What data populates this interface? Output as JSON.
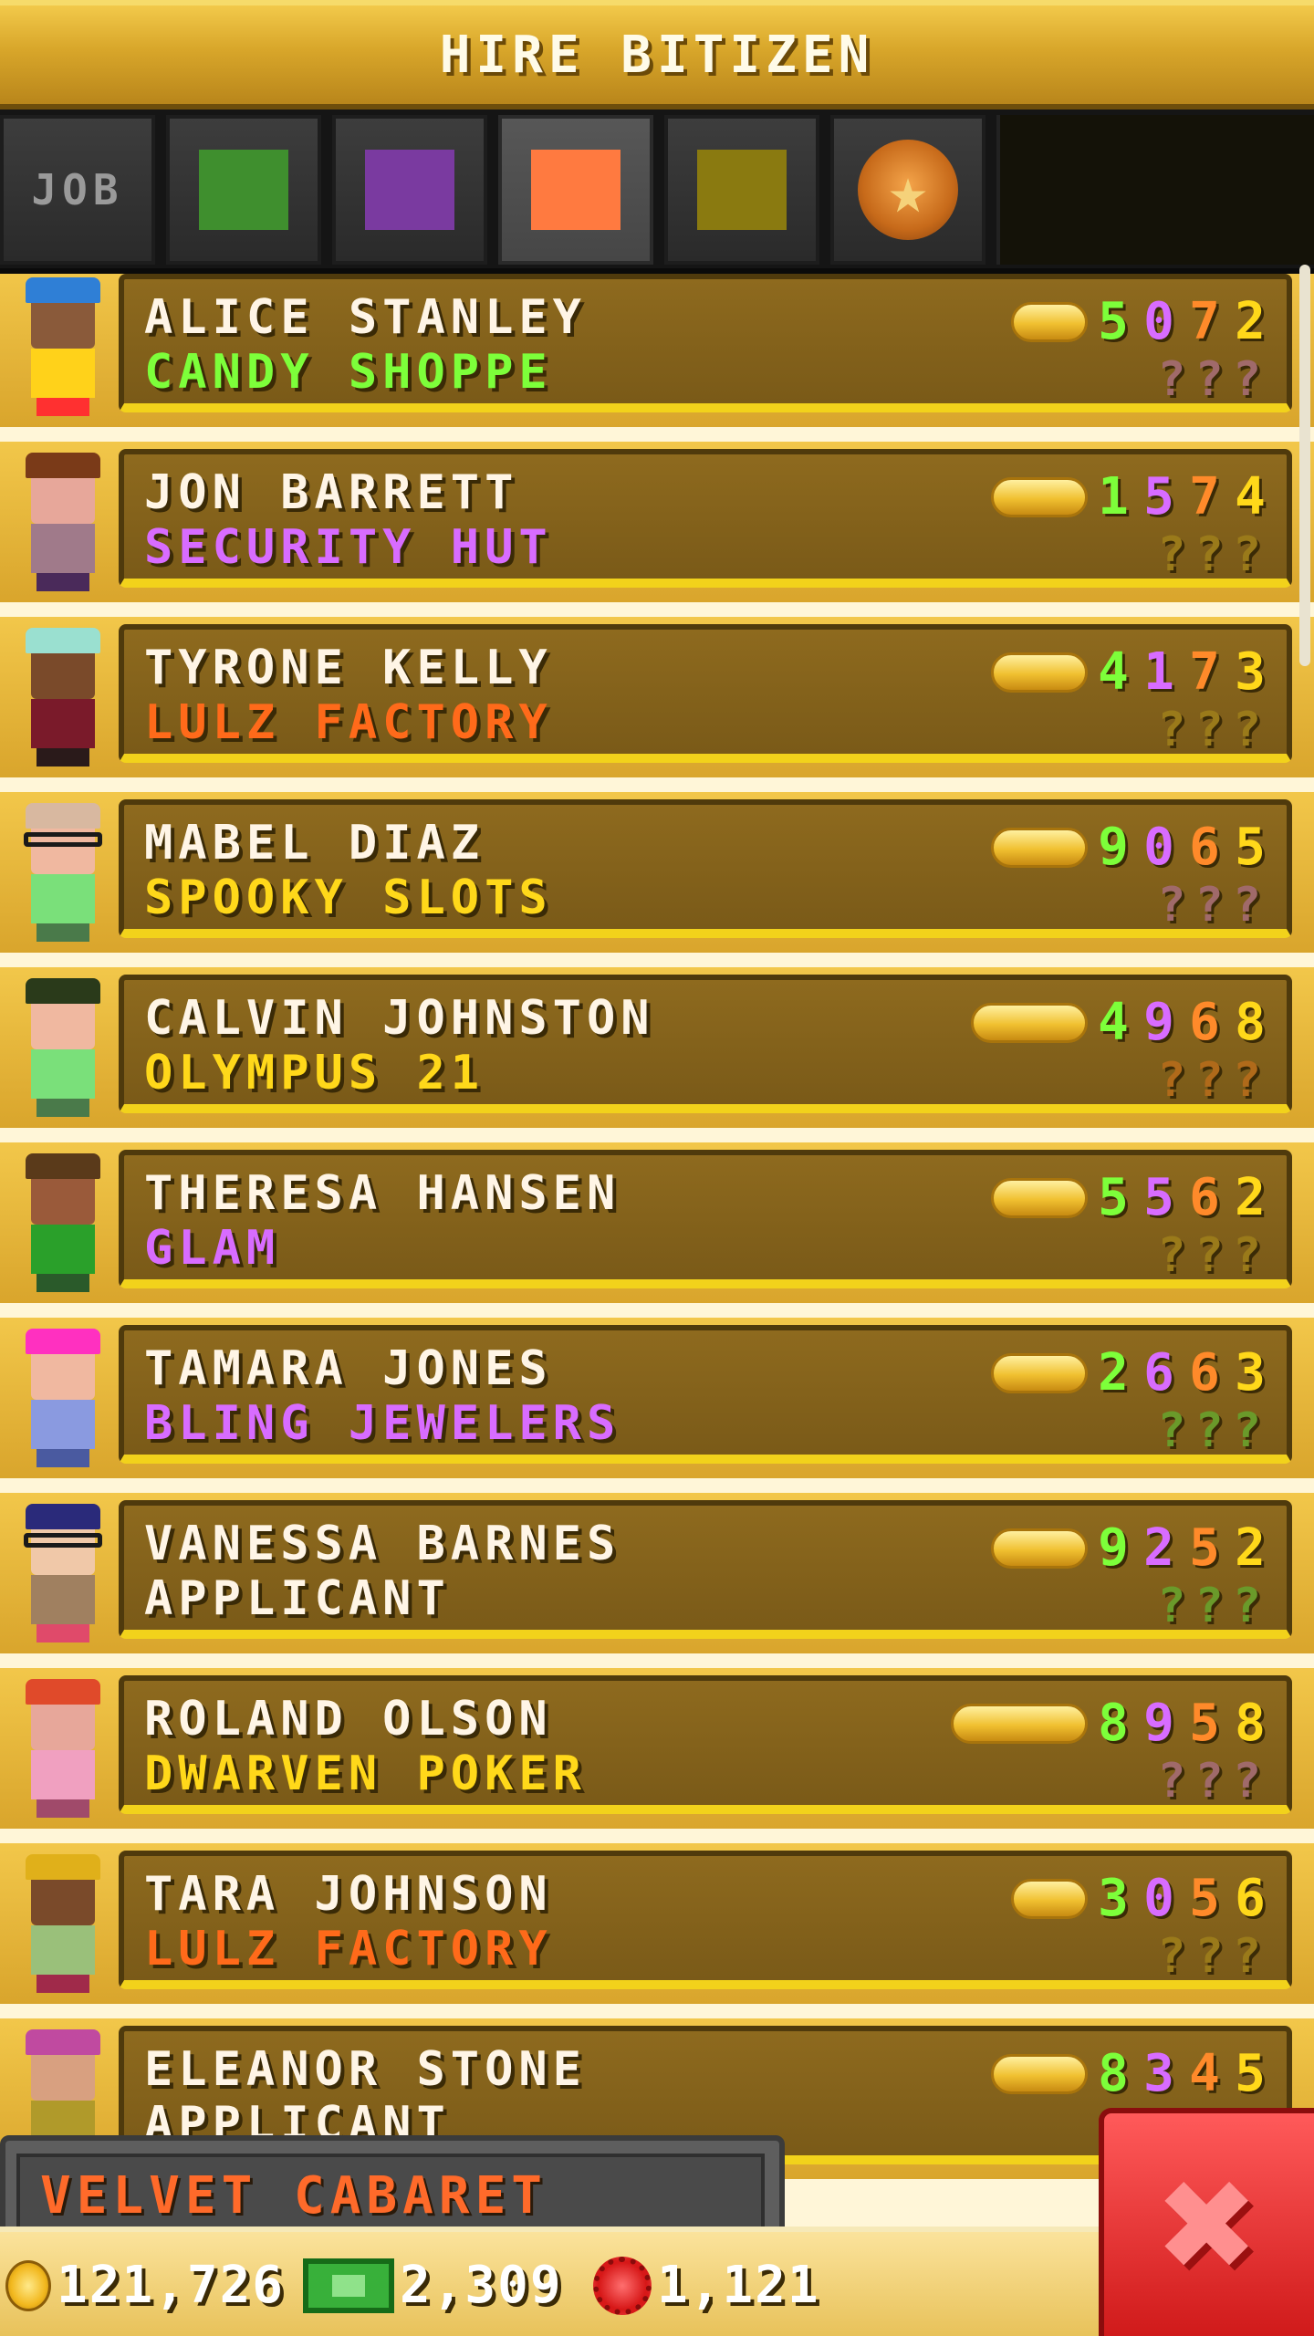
{
  "header": {
    "title": "HIRE BITIZEN"
  },
  "tabs": [
    {
      "label": "JOB",
      "kind": "text"
    },
    {
      "kind": "color",
      "color": "#3f8f2e"
    },
    {
      "kind": "color",
      "color": "#7a3aa0"
    },
    {
      "kind": "color",
      "color": "#ff7a40",
      "active": true
    },
    {
      "kind": "color",
      "color": "#8a7a10"
    },
    {
      "kind": "badge",
      "icon": "star-badge-icon",
      "glyph": "★"
    }
  ],
  "colors": {
    "green": "#7dff3a",
    "purple": "#d86cff",
    "orange": "#ff8a2a",
    "yellow": "#ffd81a",
    "white": "#fff5e6"
  },
  "rows": [
    {
      "name": "ALICE STANLEY",
      "job": "CANDY SHOPPE",
      "job_color": "#7dff3a",
      "coins": 2,
      "stats": [
        "5",
        "0",
        "7",
        "2"
      ],
      "stat_colors": [
        "#7dff3a",
        "#d86cff",
        "#ff8a2a",
        "#ffd81a"
      ],
      "unknown": "???",
      "unknown_color": "#a06a6a",
      "avatar": {
        "hair": "#2f7fd6",
        "skin": "#8a5a3a",
        "shirt": "#ffd21a",
        "legs": "#ff3030"
      }
    },
    {
      "name": "JON BARRETT",
      "job": "SECURITY HUT",
      "job_color": "#d86cff",
      "coins": 3,
      "stats": [
        "1",
        "5",
        "7",
        "4"
      ],
      "stat_colors": [
        "#7dff3a",
        "#d86cff",
        "#ff8a2a",
        "#ffd81a"
      ],
      "unknown": "???",
      "unknown_color": "#9a7a1a",
      "avatar": {
        "hair": "#7a3a18",
        "skin": "#e7a79a",
        "shirt": "#a07a8a",
        "legs": "#4a2a5a"
      }
    },
    {
      "name": "TYRONE KELLY",
      "job": "LULZ FACTORY",
      "job_color": "#ff6a1a",
      "coins": 3,
      "stats": [
        "4",
        "1",
        "7",
        "3"
      ],
      "stat_colors": [
        "#7dff3a",
        "#d86cff",
        "#ff8a2a",
        "#ffd81a"
      ],
      "unknown": "???",
      "unknown_color": "#9a7a1a",
      "avatar": {
        "hair": "#9ae0d0",
        "skin": "#7a4a2a",
        "shirt": "#7a1a2a",
        "legs": "#2a1a1a"
      }
    },
    {
      "name": "MABEL DIAZ",
      "job": "SPOOKY SLOTS",
      "job_color": "#ffd81a",
      "coins": 3,
      "stats": [
        "9",
        "0",
        "6",
        "5"
      ],
      "stat_colors": [
        "#7dff3a",
        "#d86cff",
        "#ff8a2a",
        "#ffd81a"
      ],
      "unknown": "???",
      "unknown_color": "#a06a6a",
      "avatar": {
        "hair": "#d8b8a0",
        "skin": "#f0b8a0",
        "shirt": "#7ae07a",
        "legs": "#4a7a4a",
        "glasses": true
      }
    },
    {
      "name": "CALVIN JOHNSTON",
      "job": "OLYMPUS 21",
      "job_color": "#ffd81a",
      "coins": 4,
      "stats": [
        "4",
        "9",
        "6",
        "8"
      ],
      "stat_colors": [
        "#7dff3a",
        "#d86cff",
        "#ff8a2a",
        "#ffd81a"
      ],
      "unknown": "???",
      "unknown_color": "#b06a1a",
      "avatar": {
        "hair": "#2a3a1a",
        "skin": "#f0b8a0",
        "shirt": "#7ae07a",
        "legs": "#4a7a4a"
      }
    },
    {
      "name": "THERESA HANSEN",
      "job": "GLAM",
      "job_color": "#d86cff",
      "coins": 3,
      "stats": [
        "5",
        "5",
        "6",
        "2"
      ],
      "stat_colors": [
        "#7dff3a",
        "#d86cff",
        "#ff8a2a",
        "#ffd81a"
      ],
      "unknown": "???",
      "unknown_color": "#9a7a1a",
      "avatar": {
        "hair": "#5a3a1a",
        "skin": "#9a5a3a",
        "shirt": "#2aa02a",
        "legs": "#2a5a2a"
      }
    },
    {
      "name": "TAMARA JONES",
      "job": "BLING JEWELERS",
      "job_color": "#d86cff",
      "coins": 3,
      "stats": [
        "2",
        "6",
        "6",
        "3"
      ],
      "stat_colors": [
        "#7dff3a",
        "#d86cff",
        "#ff8a2a",
        "#ffd81a"
      ],
      "unknown": "???",
      "unknown_color": "#6a9a2a",
      "avatar": {
        "hair": "#ff30c0",
        "skin": "#f0b8a0",
        "shirt": "#8a9ae0",
        "legs": "#4a5aa0"
      }
    },
    {
      "name": "VANESSA BARNES",
      "job": "APPLICANT",
      "job_color": "#fff5e6",
      "coins": 3,
      "stats": [
        "9",
        "2",
        "5",
        "2"
      ],
      "stat_colors": [
        "#7dff3a",
        "#d86cff",
        "#ff8a2a",
        "#ffd81a"
      ],
      "unknown": "???",
      "unknown_color": "#6a9a2a",
      "avatar": {
        "hair": "#2a2a7a",
        "skin": "#f0c8a8",
        "shirt": "#a08060",
        "legs": "#e04a6a",
        "glasses": true
      }
    },
    {
      "name": "ROLAND OLSON",
      "job": "DWARVEN POKER",
      "job_color": "#ffd81a",
      "coins": 5,
      "stats": [
        "8",
        "9",
        "5",
        "8"
      ],
      "stat_colors": [
        "#7dff3a",
        "#d86cff",
        "#ff8a2a",
        "#ffd81a"
      ],
      "unknown": "???",
      "unknown_color": "#a06a6a",
      "avatar": {
        "hair": "#e04a2a",
        "skin": "#e7a79a",
        "shirt": "#f0a0c0",
        "legs": "#a04a6a"
      }
    },
    {
      "name": "TARA JOHNSON",
      "job": "LULZ FACTORY",
      "job_color": "#ff6a1a",
      "coins": 2,
      "stats": [
        "3",
        "0",
        "5",
        "6"
      ],
      "stat_colors": [
        "#7dff3a",
        "#d86cff",
        "#ff8a2a",
        "#ffd81a"
      ],
      "unknown": "???",
      "unknown_color": "#9a7a1a",
      "avatar": {
        "hair": "#e0b01a",
        "skin": "#7a4a2a",
        "shirt": "#9ac07a",
        "legs": "#a02a4a"
      }
    },
    {
      "name": "ELEANOR STONE",
      "job": "APPLICANT",
      "job_color": "#fff5e6",
      "coins": 3,
      "stats": [
        "8",
        "3",
        "4",
        "5"
      ],
      "stat_colors": [
        "#7dff3a",
        "#d86cff",
        "#ff8a2a",
        "#ffd81a"
      ],
      "unknown": "???",
      "unknown_color": "#b06a1a",
      "avatar": {
        "hair": "#c04aa0",
        "skin": "#d8a080",
        "shirt": "#b09a2a",
        "legs": "#6a5a1a"
      }
    }
  ],
  "building_tab": {
    "label": "VELVET CABARET"
  },
  "footer": {
    "coins": "121,726",
    "bux": "2,309",
    "points": "1,121"
  },
  "close": {
    "glyph": "✖"
  }
}
